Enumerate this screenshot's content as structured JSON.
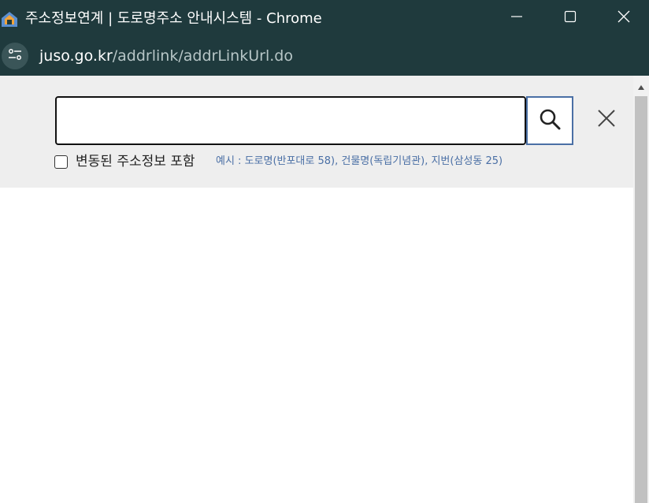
{
  "window": {
    "title": "주소정보연계 | 도로명주소 안내시스템 - Chrome",
    "app_icon": "juso-house-icon",
    "controls": [
      "minimize-icon",
      "maximize-icon",
      "close-icon"
    ]
  },
  "address_bar": {
    "site_info_icon": "tune-icon",
    "url_host": "juso.go.kr",
    "url_path": "/addrlink/addrLinkUrl.do"
  },
  "search": {
    "input_value": "",
    "search_icon": "search-icon",
    "close_icon": "close-icon",
    "checkbox_label": "변동된 주소정보 포함",
    "checkbox_checked": false,
    "example": "예시 : 도로명(반포대로 58), 건물명(독립기념관), 지번(삼성동 25)"
  },
  "colors": {
    "chrome_frame": "#1f3a3d",
    "panel_bg": "#eeeeee",
    "accent": "#4a6fa5",
    "example_text": "#4a6fa5"
  }
}
